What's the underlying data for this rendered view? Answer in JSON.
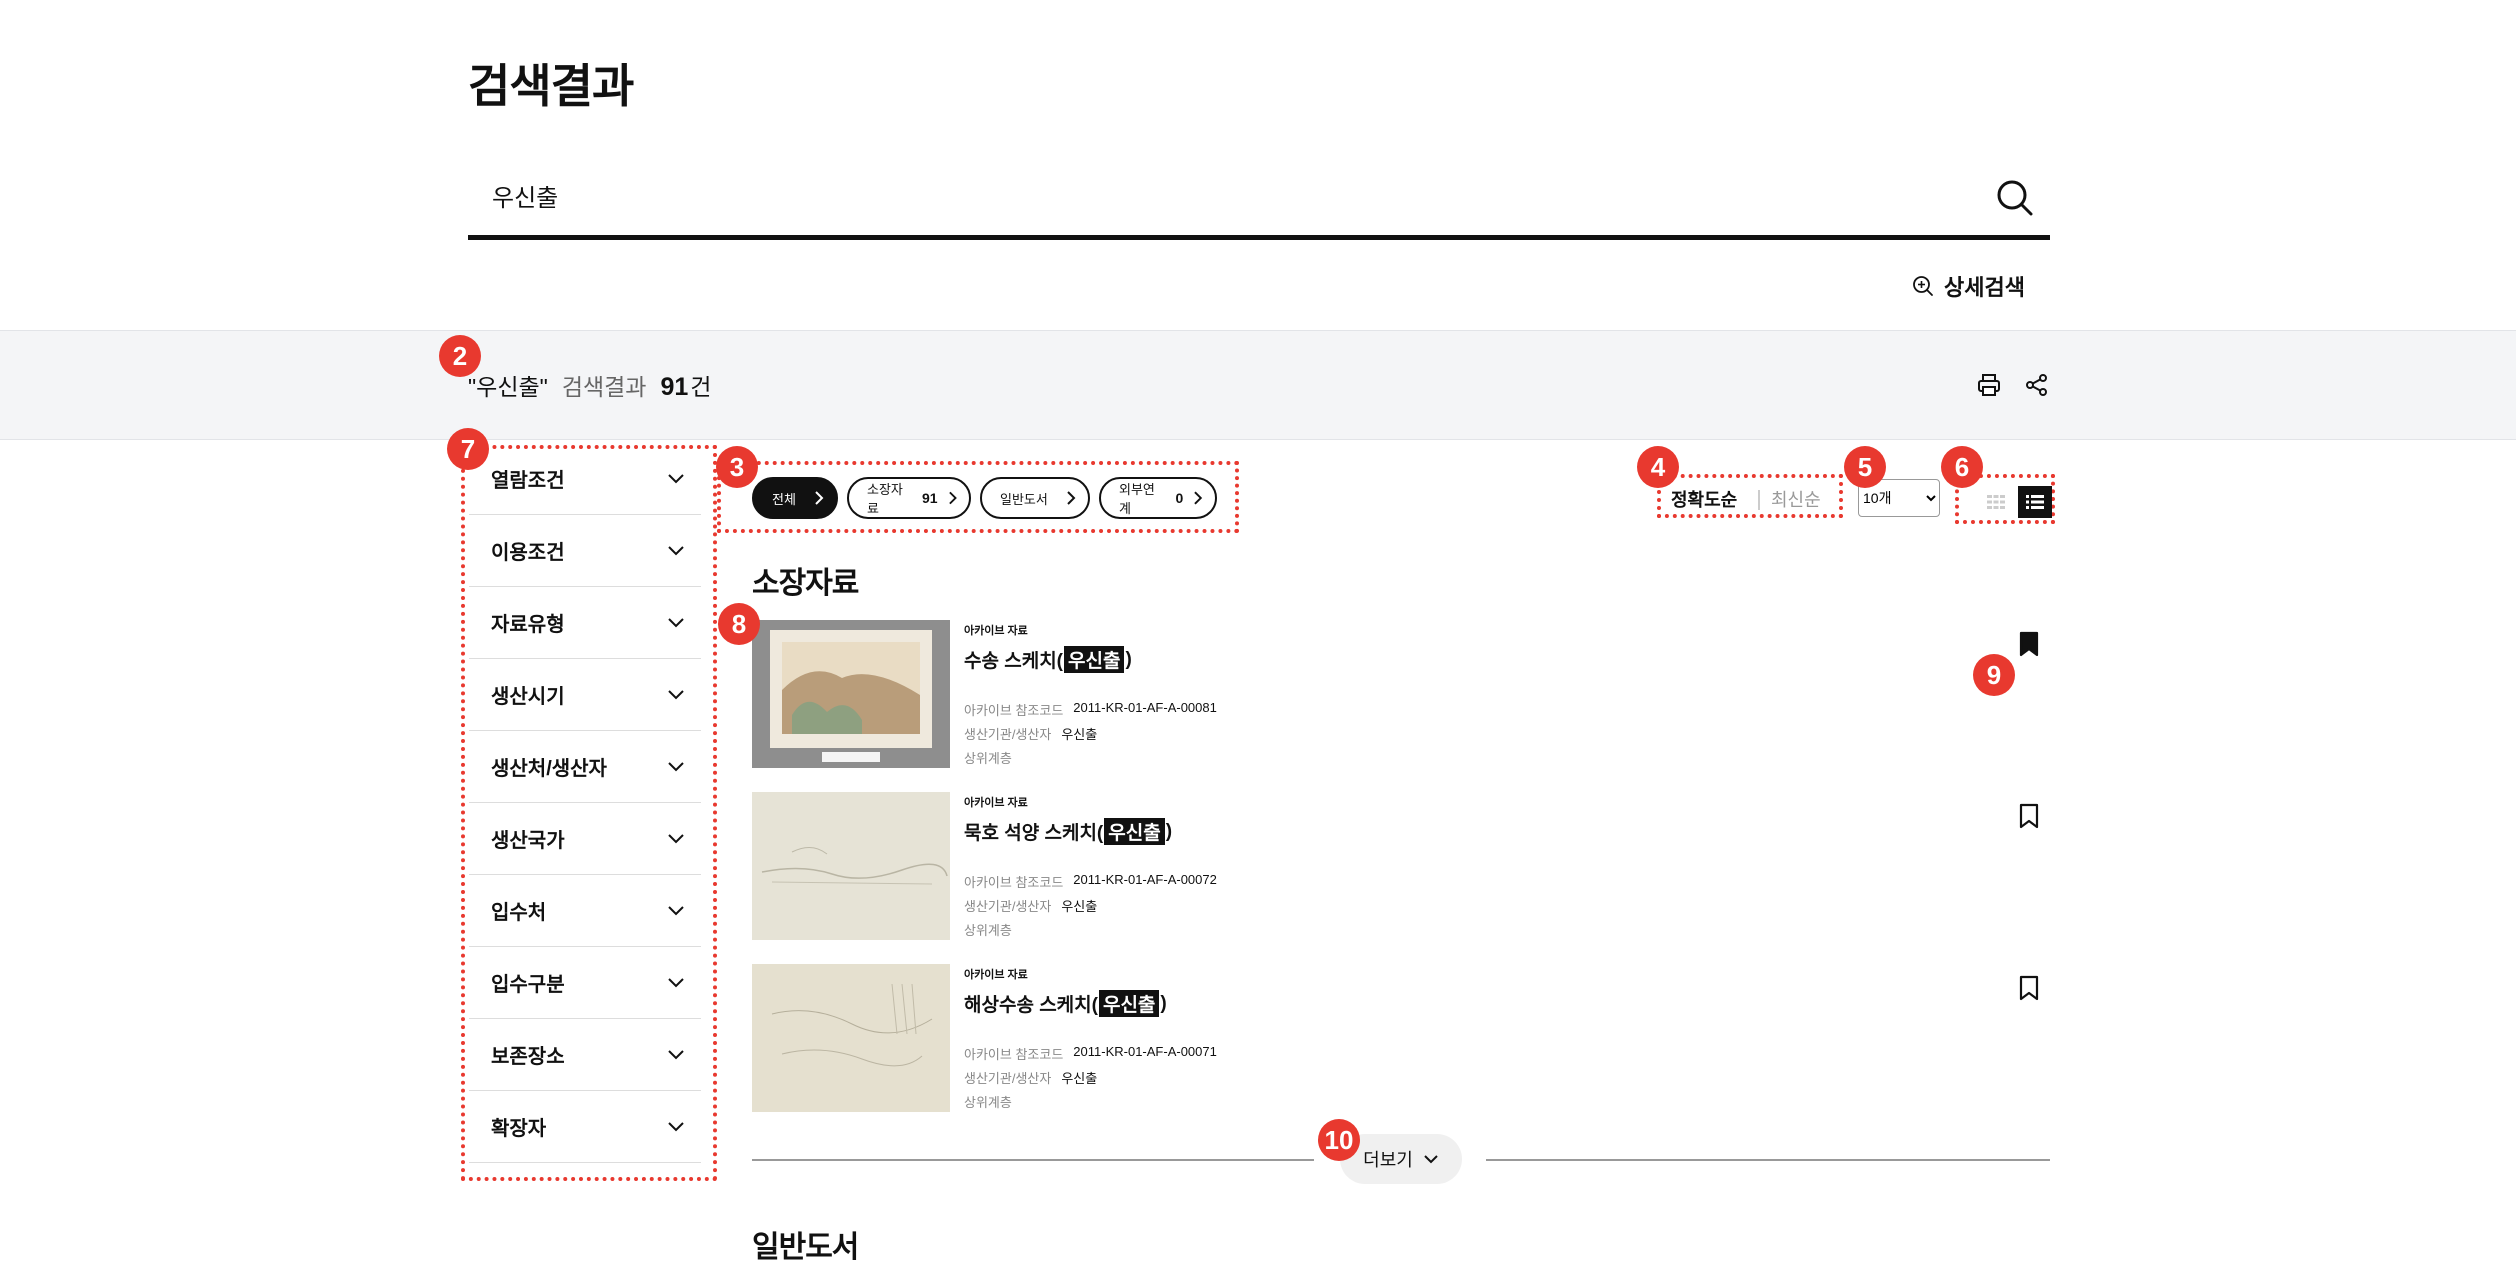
{
  "page": {
    "title": "검색결과"
  },
  "search": {
    "value": "우신출",
    "placeholder": ""
  },
  "advanced_search": {
    "label": "상세검색"
  },
  "summary": {
    "query": "\"우신출\"",
    "label": "검색결과",
    "count": "91",
    "unit": "건"
  },
  "markers": {
    "m2": "2",
    "m3": "3",
    "m4": "4",
    "m5": "5",
    "m6": "6",
    "m7": "7",
    "m8": "8",
    "m9": "9",
    "m10": "10"
  },
  "filters": [
    {
      "label": "열람조건"
    },
    {
      "label": "이용조건"
    },
    {
      "label": "자료유형"
    },
    {
      "label": "생산시기"
    },
    {
      "label": "생산처/생산자"
    },
    {
      "label": "생산국가"
    },
    {
      "label": "입수처"
    },
    {
      "label": "입수구분"
    },
    {
      "label": "보존장소"
    },
    {
      "label": "확장자"
    }
  ],
  "categories": [
    {
      "label": "전체",
      "count": "",
      "active": true
    },
    {
      "label": "소장자료",
      "count": "91",
      "active": false
    },
    {
      "label": "일반도서",
      "count": "",
      "active": false
    },
    {
      "label": "외부연계",
      "count": "0",
      "active": false
    }
  ],
  "sort": {
    "accuracy": "정확도순",
    "latest": "최신순",
    "selected": "정확도순"
  },
  "page_size": {
    "selected": "10개",
    "options": [
      "10개"
    ]
  },
  "view_mode": {
    "selected": "list"
  },
  "section": {
    "title": "소장자료",
    "next_title": "일반도서"
  },
  "results": [
    {
      "type": "아카이브 자료",
      "title_prefix": "수송 스케치(",
      "title_highlight": "우신출",
      "title_suffix": ")",
      "ref_label": "아카이브 참조코드",
      "ref_value": "2011-KR-01-AF-A-00081",
      "producer_label": "생산기관/생산자",
      "producer_value": "우신출",
      "parent_label": "상위계층",
      "bookmarked": true
    },
    {
      "type": "아카이브 자료",
      "title_prefix": "묵호 석양 스케치(",
      "title_highlight": "우신출",
      "title_suffix": ")",
      "ref_label": "아카이브 참조코드",
      "ref_value": "2011-KR-01-AF-A-00072",
      "producer_label": "생산기관/생산자",
      "producer_value": "우신출",
      "parent_label": "상위계층",
      "bookmarked": false
    },
    {
      "type": "아카이브 자료",
      "title_prefix": "해상수송 스케치(",
      "title_highlight": "우신출",
      "title_suffix": ")",
      "ref_label": "아카이브 참조코드",
      "ref_value": "2011-KR-01-AF-A-00071",
      "producer_label": "생산기관/생산자",
      "producer_value": "우신출",
      "parent_label": "상위계층",
      "bookmarked": false
    }
  ],
  "more": {
    "label": "더보기"
  },
  "colors": {
    "accent": "#e8392f",
    "primary": "#111111",
    "band": "#f4f5f7"
  }
}
